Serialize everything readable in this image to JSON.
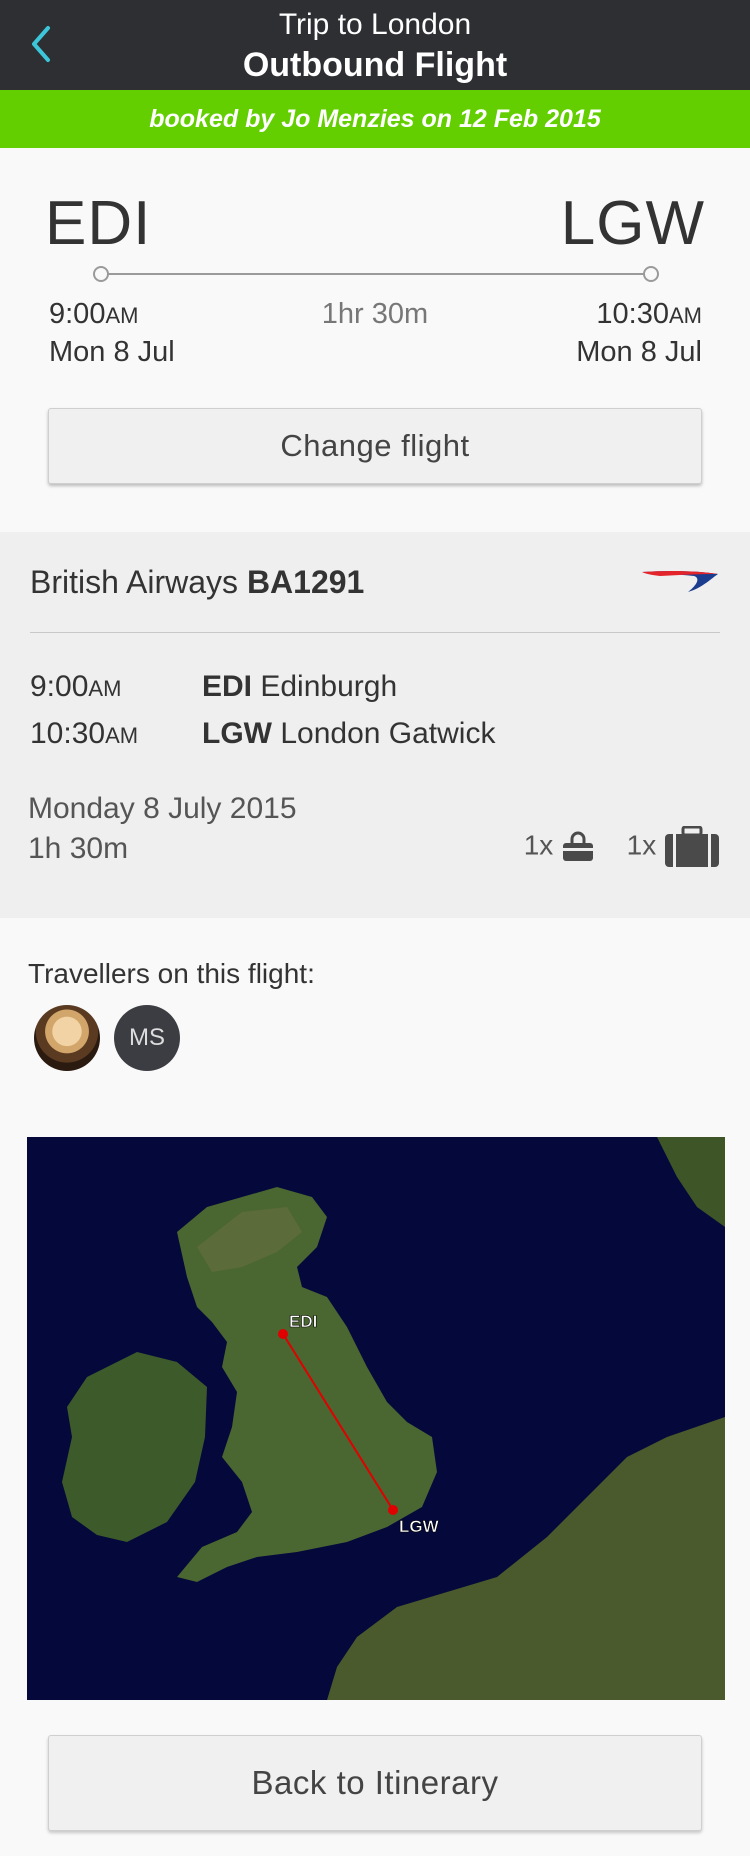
{
  "header": {
    "back_icon": "chevron-left-icon",
    "trip_title": "Trip to London",
    "page_title": "Outbound Flight"
  },
  "banner": {
    "text": "booked by Jo Menzies on 12 Feb 2015"
  },
  "summary": {
    "from_code": "EDI",
    "to_code": "LGW",
    "depart_time": "9:00",
    "depart_ampm": "AM",
    "depart_date": "Mon 8 Jul",
    "duration": "1hr 30m",
    "arrive_time": "10:30",
    "arrive_ampm": "AM",
    "arrive_date": "Mon 8 Jul",
    "change_label": "Change flight"
  },
  "flight": {
    "airline": "British Airways",
    "number": "BA1291",
    "logo_icon": "british-airways-logo",
    "legs": [
      {
        "time": "9:00",
        "ampm": "AM",
        "code": "EDI",
        "city": "Edinburgh"
      },
      {
        "time": "10:30",
        "ampm": "AM",
        "code": "LGW",
        "city": "London Gatwick"
      }
    ],
    "full_date": "Monday 8 July 2015",
    "duration": "1h 30m",
    "hand_baggage_count": "1x",
    "hold_baggage_count": "1x"
  },
  "travellers": {
    "label": "Travellers on this flight:",
    "people": [
      {
        "type": "photo"
      },
      {
        "initials": "MS"
      }
    ]
  },
  "map": {
    "origin_label": "EDI",
    "destination_label": "LGW",
    "route_color": "#e00000"
  },
  "footer": {
    "back_label": "Back to Itinerary"
  },
  "colors": {
    "header": "#2d2f33",
    "banner": "#63cf00",
    "accent": "#3cc6d9"
  }
}
